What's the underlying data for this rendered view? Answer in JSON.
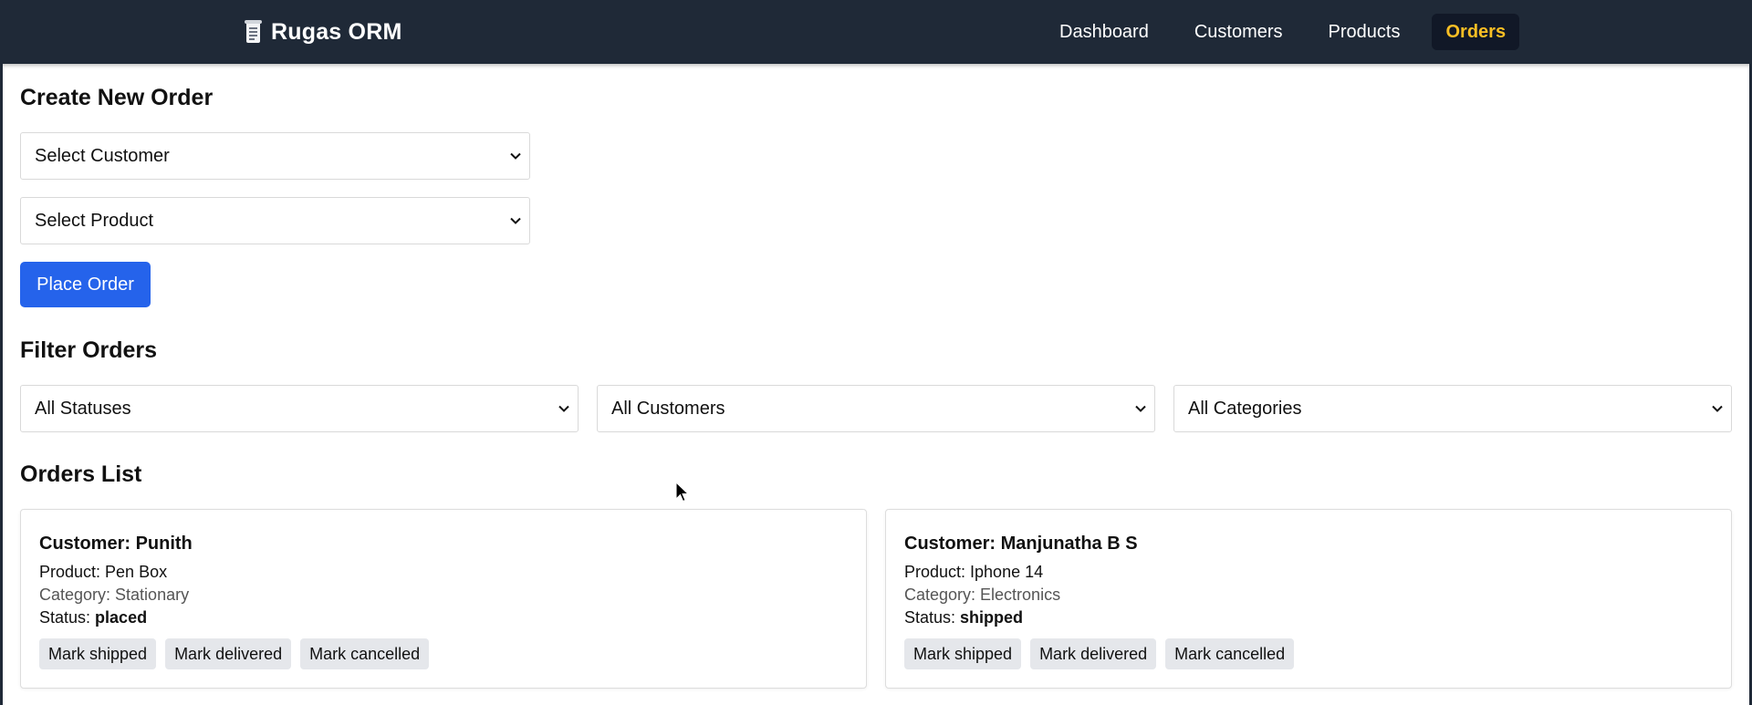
{
  "navbar": {
    "brand_icon": "receipt-icon",
    "brand": "Rugas ORM",
    "links": [
      {
        "label": "Dashboard",
        "active": false
      },
      {
        "label": "Customers",
        "active": false
      },
      {
        "label": "Products",
        "active": false
      },
      {
        "label": "Orders",
        "active": true
      }
    ],
    "background": "#1f2937",
    "active_color": "#fbbf24"
  },
  "create": {
    "heading": "Create New Order",
    "customer_select": "Select Customer",
    "product_select": "Select Product",
    "submit_label": "Place Order",
    "submit_color": "#2563eb"
  },
  "filter": {
    "heading": "Filter Orders",
    "status_select": "All Statuses",
    "customer_select": "All Customers",
    "category_select": "All Categories"
  },
  "list": {
    "heading": "Orders List",
    "orders": [
      {
        "title": "Customer: Punith",
        "product": "Product: Pen Box",
        "category": "Category: Stationary",
        "status_label": "Status:",
        "status": "placed",
        "actions": [
          "Mark shipped",
          "Mark delivered",
          "Mark cancelled"
        ]
      },
      {
        "title": "Customer: Manjunatha B S",
        "product": "Product: Iphone 14",
        "category": "Category: Electronics",
        "status_label": "Status:",
        "status": "shipped",
        "actions": [
          "Mark shipped",
          "Mark delivered",
          "Mark cancelled"
        ]
      }
    ]
  }
}
